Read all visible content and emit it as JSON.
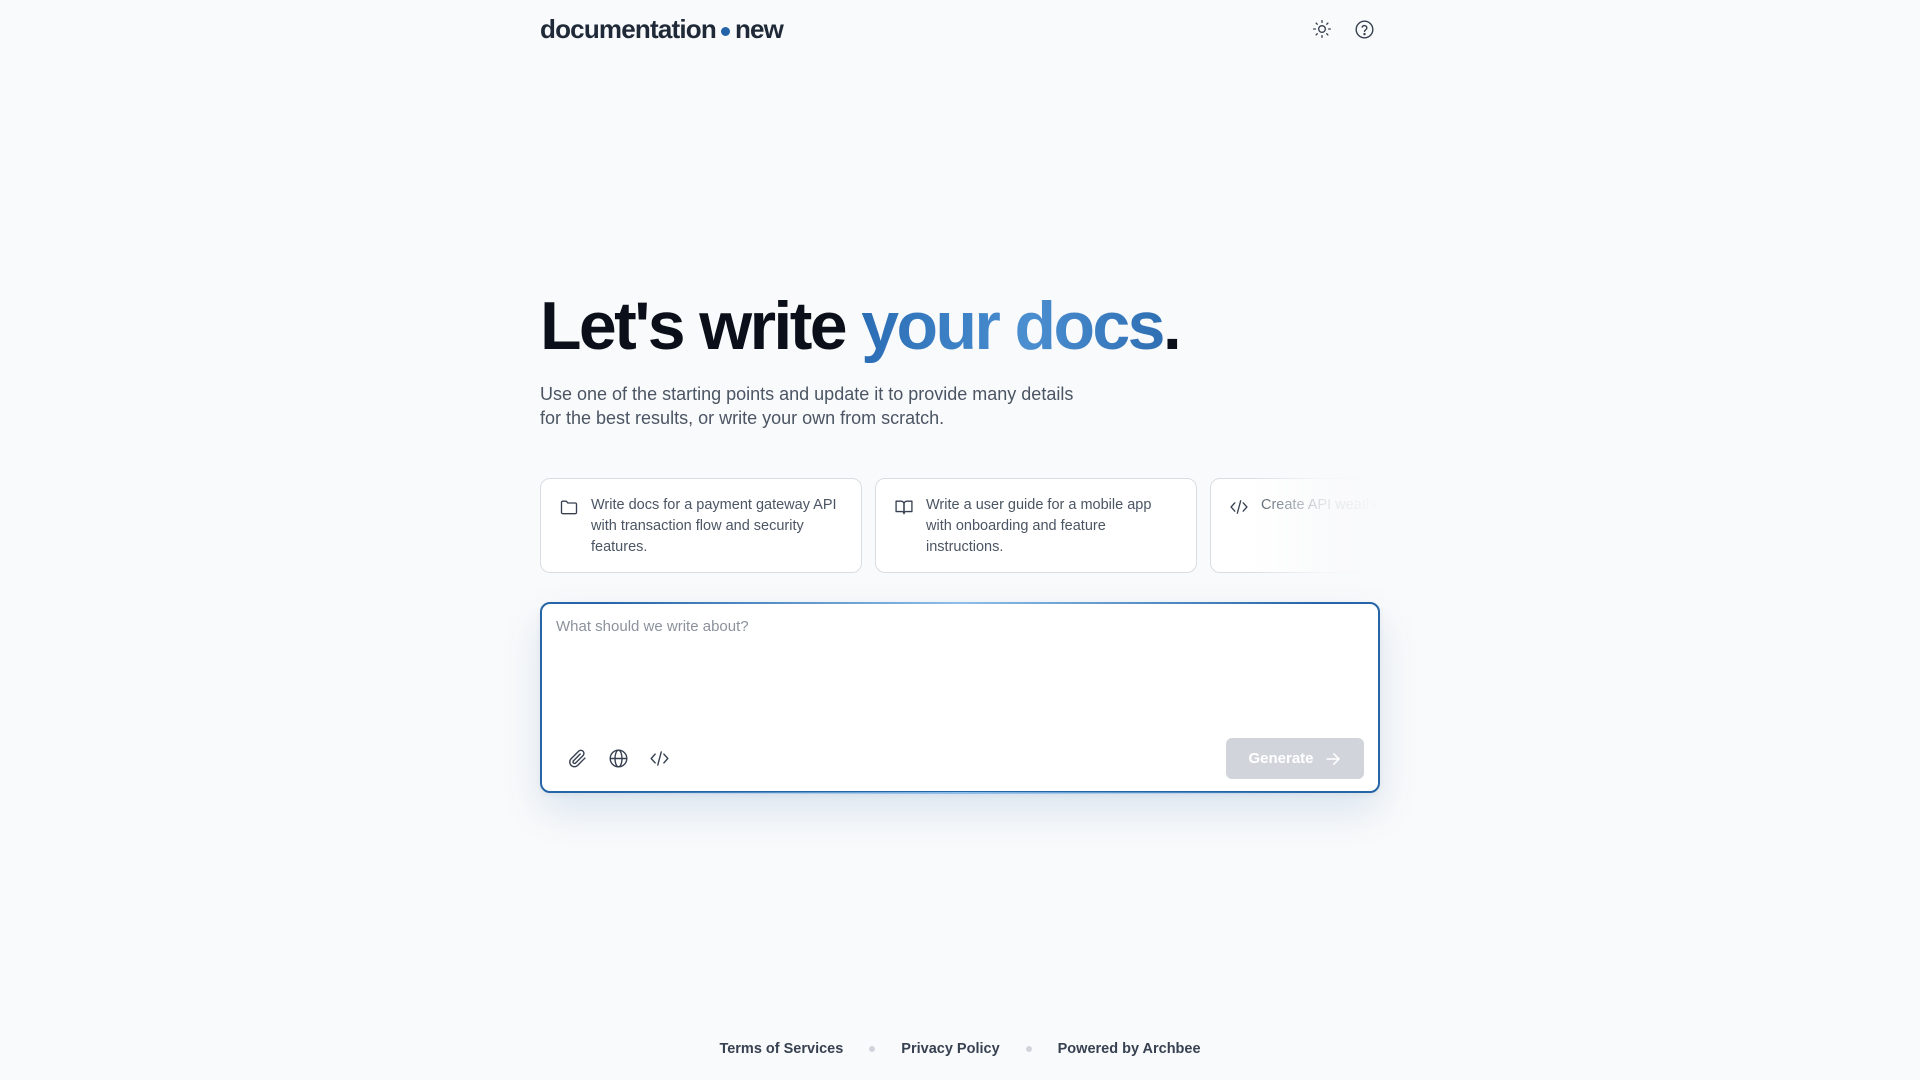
{
  "header": {
    "logo_left": "documentation",
    "logo_right": "new",
    "theme_toggle_icon": "sun-icon",
    "help_icon": "help-circle-icon"
  },
  "hero": {
    "title_start": "Let's write ",
    "title_accent": "your docs",
    "title_end": ".",
    "subtitle_line1": "Use one of the starting points and update it to provide many details",
    "subtitle_line2": "for the best results, or write your own from scratch."
  },
  "suggestions": [
    {
      "icon": "folder-icon",
      "text": "Write docs for a payment gateway API with transaction flow and security features."
    },
    {
      "icon": "book-open-icon",
      "text": "Write a user guide for a mobile app with onboarding and feature instructions."
    },
    {
      "icon": "code-icon",
      "text": "Create API weather da authenticat"
    }
  ],
  "prompt": {
    "placeholder": "What should we write about?",
    "value": "",
    "tools": [
      "paperclip-icon",
      "globe-icon",
      "code-icon"
    ],
    "generate_label": "Generate",
    "generate_enabled": false
  },
  "footer": {
    "links": [
      "Terms of Services",
      "Privacy Policy",
      "Powered by Archbee"
    ]
  },
  "colors": {
    "background": "#f9fafb",
    "accent": "#2565a8",
    "accent_light": "#4b8fd1",
    "button_disabled": "#d1d5db"
  }
}
